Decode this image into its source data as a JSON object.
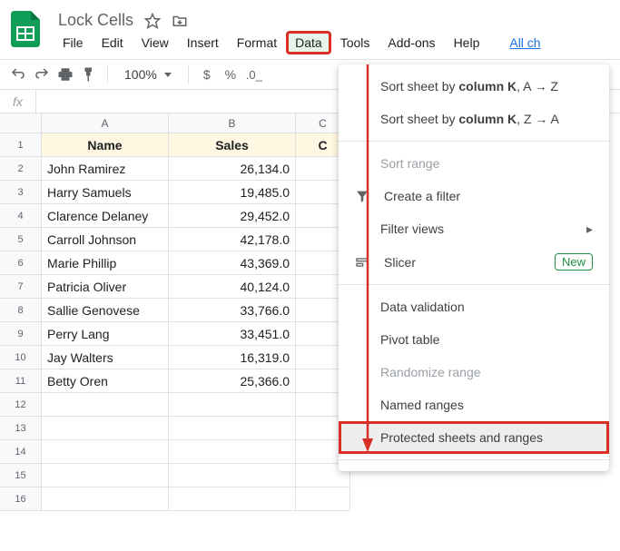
{
  "header": {
    "doc_title": "Lock Cells",
    "menus": [
      "File",
      "Edit",
      "View",
      "Insert",
      "Format",
      "Data",
      "Tools",
      "Add-ons",
      "Help"
    ],
    "active_menu_index": 5,
    "allchanges_label": "All ch"
  },
  "toolbar": {
    "zoom": "100%",
    "currency": "$",
    "percent": "%"
  },
  "fx": {
    "label": "fx"
  },
  "columns": [
    "A",
    "B",
    "C"
  ],
  "row_numbers": [
    1,
    2,
    3,
    4,
    5,
    6,
    7,
    8,
    9,
    10,
    11,
    12,
    13,
    14,
    15,
    16
  ],
  "table": {
    "headers": [
      "Name",
      "Sales",
      "C"
    ],
    "rows": [
      [
        "John Ramirez",
        "26,134.0"
      ],
      [
        "Harry Samuels",
        "19,485.0"
      ],
      [
        "Clarence Delaney",
        "29,452.0"
      ],
      [
        "Carroll Johnson",
        "42,178.0"
      ],
      [
        "Marie Phillip",
        "43,369.0"
      ],
      [
        "Patricia Oliver",
        "40,124.0"
      ],
      [
        "Sallie Genovese",
        "33,766.0"
      ],
      [
        "Perry Lang",
        "33,451.0"
      ],
      [
        "Jay Walters",
        "16,319.0"
      ],
      [
        "Betty Oren",
        "25,366.0"
      ]
    ]
  },
  "dropdown": {
    "sort_az_prefix": "Sort sheet by ",
    "sort_col": "column K",
    "sort_az_suffix": ", A → Z",
    "sort_za_suffix": ", Z → A",
    "sort_range": "Sort range",
    "create_filter": "Create a filter",
    "filter_views": "Filter views",
    "slicer": "Slicer",
    "new_badge": "New",
    "data_validation": "Data validation",
    "pivot_table": "Pivot table",
    "randomize_range": "Randomize range",
    "named_ranges": "Named ranges",
    "protected": "Protected sheets and ranges"
  }
}
